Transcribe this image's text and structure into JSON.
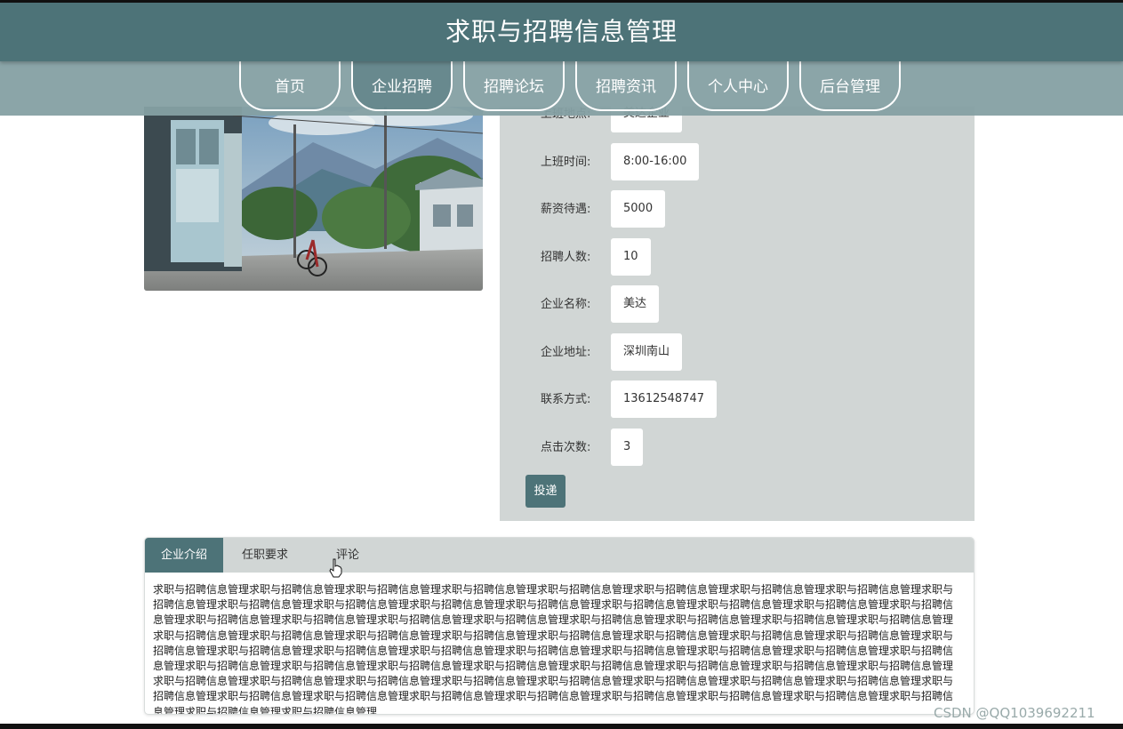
{
  "header": {
    "title": "求职与招聘信息管理"
  },
  "nav": {
    "items": [
      {
        "label": "首页"
      },
      {
        "label": "企业招聘"
      },
      {
        "label": "招聘论坛"
      },
      {
        "label": "招聘资讯"
      },
      {
        "label": "个人中心"
      },
      {
        "label": "后台管理"
      }
    ],
    "active_index": 1
  },
  "detail": {
    "fields": [
      {
        "label": "上班地点:",
        "value": "美达企业"
      },
      {
        "label": "上班时间:",
        "value": "8:00-16:00"
      },
      {
        "label": "薪资待遇:",
        "value": "5000"
      },
      {
        "label": "招聘人数:",
        "value": "10"
      },
      {
        "label": "企业名称:",
        "value": "美达"
      },
      {
        "label": "企业地址:",
        "value": "深圳南山"
      },
      {
        "label": "联系方式:",
        "value": "13612548747"
      },
      {
        "label": "点击次数:",
        "value": "3"
      }
    ],
    "submit_label": "投递"
  },
  "tabs": {
    "items": [
      {
        "label": "企业介绍"
      },
      {
        "label": "任职要求"
      },
      {
        "label": "评论"
      }
    ],
    "active_index": 0,
    "content": "求职与招聘信息管理求职与招聘信息管理求职与招聘信息管理求职与招聘信息管理求职与招聘信息管理求职与招聘信息管理求职与招聘信息管理求职与招聘信息管理求职与招聘信息管理求职与招聘信息管理求职与招聘信息管理求职与招聘信息管理求职与招聘信息管理求职与招聘信息管理求职与招聘信息管理求职与招聘信息管理求职与招聘信息管理求职与招聘信息管理求职与招聘信息管理求职与招聘信息管理求职与招聘信息管理求职与招聘信息管理求职与招聘信息管理求职与招聘信息管理求职与招聘信息管理求职与招聘信息管理求职与招聘信息管理求职与招聘信息管理求职与招聘信息管理求职与招聘信息管理求职与招聘信息管理求职与招聘信息管理求职与招聘信息管理求职与招聘信息管理求职与招聘信息管理求职与招聘信息管理求职与招聘信息管理求职与招聘信息管理求职与招聘信息管理求职与招聘信息管理求职与招聘信息管理求职与招聘信息管理求职与招聘信息管理求职与招聘信息管理求职与招聘信息管理求职与招聘信息管理求职与招聘信息管理求职与招聘信息管理求职与招聘信息管理求职与招聘信息管理求职与招聘信息管理求职与招聘信息管理求职与招聘信息管理求职与招聘信息管理求职与招聘信息管理求职与招聘信息管理求职与招聘信息管理求职与招聘信息管理求职与招聘信息管理求职与招聘信息管理求职与招聘信息管理求职与招聘信息管理求职与招聘信息管理求职与招聘信息管理求职与招聘信息管理求职与招聘信息管理求职与招聘信息管理求职与招聘信息管理求职与招聘信息管理"
  },
  "watermark": "CSDN @QQ1039692211",
  "colors": {
    "primary": "#4d7378",
    "nav_bg": "#85a0a3",
    "panel_bg": "#d1d6d5"
  }
}
